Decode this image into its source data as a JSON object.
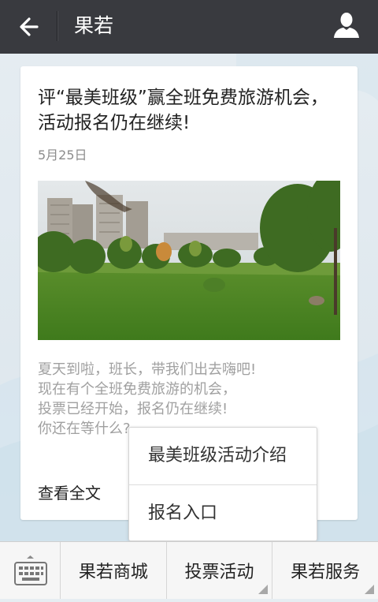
{
  "header": {
    "title": "果若",
    "back_icon": "arrow-left-icon",
    "profile_icon": "person-icon"
  },
  "article": {
    "title": "评“最美班级”赢全班免费旅游机会，活动报名仍在继续!",
    "date": "5月25日",
    "image": "campus-lawn-photo",
    "summary": "夏天到啦，班长，带我们出去嗨吧!\n现在有个全班免费旅游的机会，\n投票已经开始，报名仍在继续!\n你还在等什么?",
    "read_more": "查看全文"
  },
  "popup": {
    "items": [
      "最美班级活动介绍",
      "报名入口"
    ]
  },
  "bottom_menu": {
    "keyboard_icon": "keyboard-icon",
    "tabs": [
      "果若商城",
      "投票活动",
      "果若服务"
    ]
  },
  "colors": {
    "header_bg": "#393a3f",
    "menu_bg": "#f6f6f6",
    "summary_text": "#a0a0a0"
  }
}
